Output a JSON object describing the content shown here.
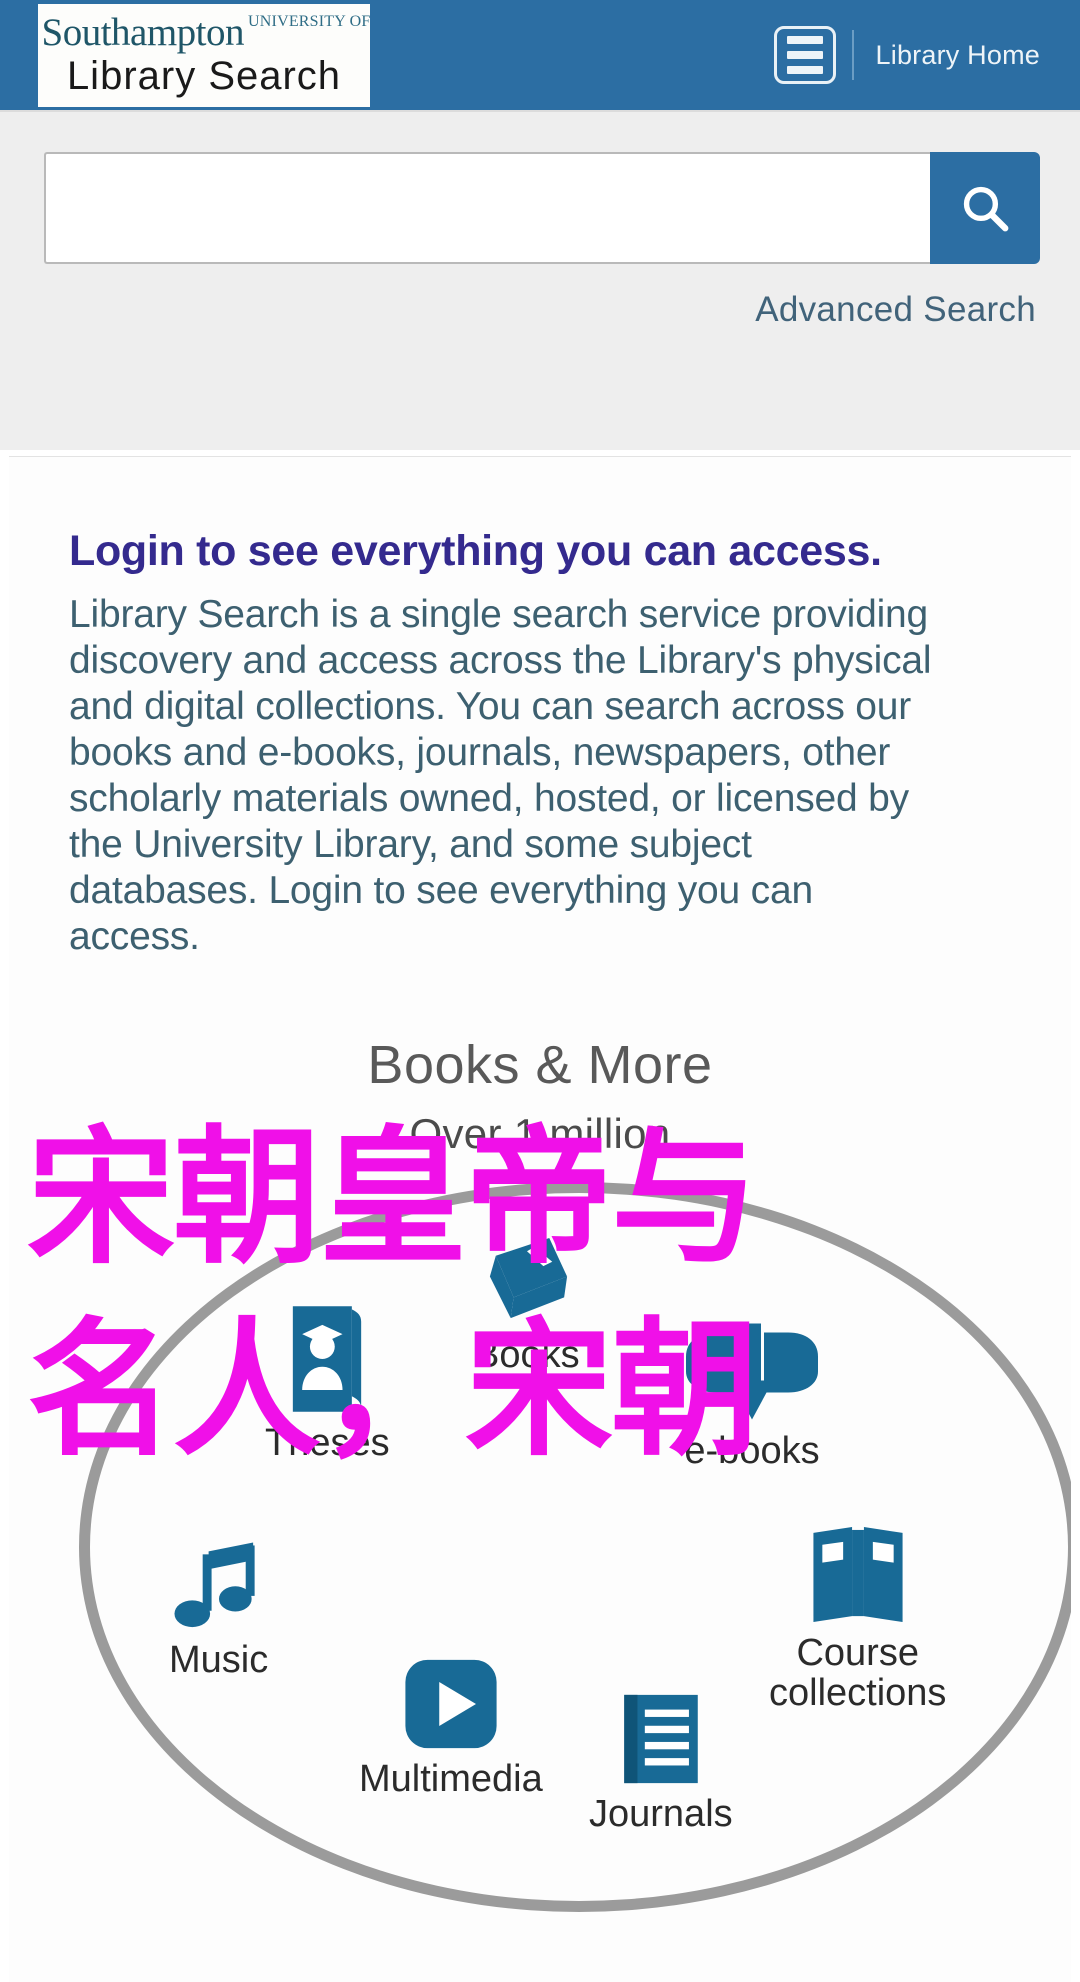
{
  "header": {
    "logo": {
      "university_line": "UNIVERSITY OF",
      "name": "Southampton",
      "product": "Library  Search"
    },
    "menu_icon": "hamburger-menu-icon",
    "library_home": "Library Home"
  },
  "search": {
    "value": "",
    "placeholder": "",
    "button_icon": "search-icon",
    "advanced_search": "Advanced Search"
  },
  "main": {
    "heading": "Login to see everything you can access.",
    "body": "Library Search is a single search service providing discovery and access across the Library's physical and digital collections. You can search across our books and e-books, journals, newspapers, other scholarly materials owned, hosted, or licensed by the University Library, and some subject databases. Login to see everything you can access."
  },
  "overlay": {
    "line1": "宋朝皇帝与",
    "line2": "名人，宋朝",
    "color": "#f010e8"
  },
  "graphic": {
    "title": "Books & More",
    "subtitle": "Over 1 million",
    "nodes": [
      {
        "label": "Theses",
        "icon": "thesis-icon"
      },
      {
        "label": "Books",
        "icon": "book-icon"
      },
      {
        "label": "e-books",
        "icon": "ebook-download-icon"
      },
      {
        "label": "Music",
        "icon": "music-note-icon"
      },
      {
        "label": "Course\ncollections",
        "icon": "open-book-icon"
      },
      {
        "label": "Multimedia",
        "icon": "play-button-icon"
      },
      {
        "label": "Journals",
        "icon": "journal-icon"
      }
    ]
  },
  "colors": {
    "brand_blue": "#2c6ea3",
    "icon_blue": "#186a96",
    "heading_purple": "#342a8e",
    "body_teal": "#3d6070",
    "overlay_magenta": "#f010e8"
  }
}
